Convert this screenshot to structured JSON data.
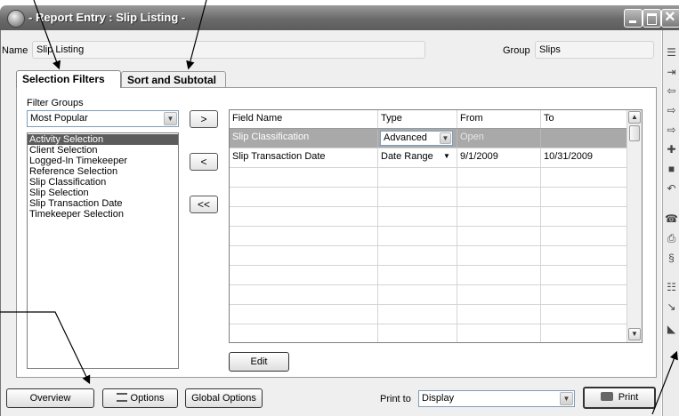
{
  "window": {
    "title": "- Report Entry : Slip Listing -"
  },
  "header": {
    "name_label": "Name",
    "name_value": "Slip Listing",
    "group_label": "Group",
    "group_value": "Slips"
  },
  "tabs": [
    {
      "label": "Selection Filters",
      "active": true
    },
    {
      "label": "Sort and Subtotal",
      "active": false
    }
  ],
  "filters": {
    "groups_label": "Filter Groups",
    "groups_selected": "Most Popular",
    "list": [
      "Activity Selection",
      "Client Selection",
      "Logged-In Timekeeper",
      "Reference Selection",
      "Slip Classification",
      "Slip Selection",
      "Slip Transaction Date",
      "Timekeeper Selection"
    ],
    "selected_index": 0,
    "move_buttons": [
      ">",
      "<",
      "<<"
    ]
  },
  "grid": {
    "columns": [
      "Field Name",
      "Type",
      "From",
      "To"
    ],
    "rows": [
      {
        "field": "Slip Classification",
        "type": "Advanced",
        "from": "Open",
        "to": "",
        "selected": true
      },
      {
        "field": "Slip Transaction Date",
        "type": "Date Range",
        "from": "9/1/2009",
        "to": "10/31/2009",
        "selected": false
      }
    ],
    "empty_rows": 10
  },
  "actions": {
    "edit": "Edit",
    "overview": "Overview",
    "options": "Options",
    "global_options": "Global Options",
    "print_to_label": "Print to",
    "print_to_value": "Display",
    "print": "Print"
  },
  "icons": {
    "sidebar": [
      "notes-icon",
      "jump-icon",
      "back-icon",
      "forward-icon",
      "next-icon",
      "add-icon",
      "save-icon",
      "undo-icon",
      "phone-icon",
      "print-icon",
      "spell-icon",
      "report-icon",
      "link-icon",
      "chart-icon"
    ]
  },
  "colors": {
    "titlebar": "#6a6a6a",
    "selection": "#5c5c5c",
    "selected_row": "#a9a9a9"
  }
}
